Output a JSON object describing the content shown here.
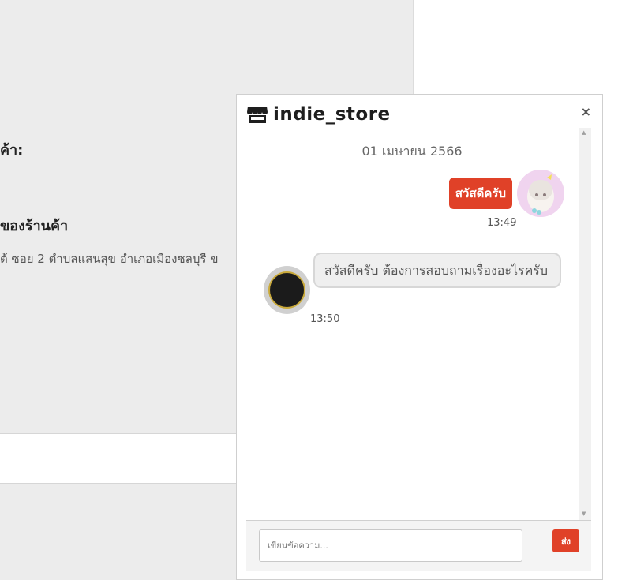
{
  "background": {
    "label_1": "ค้า:",
    "label_2": "ของร้านค้า",
    "address": "ต้ ซอย 2 ตำบลแสนสุข อำเภอเมืองชลบุรี ข"
  },
  "chat": {
    "store_icon": "store-icon",
    "store_name": "indie_store",
    "close_label": "×",
    "date": "01 เมษายน 2566",
    "messages": [
      {
        "direction": "outgoing",
        "text": "สวัสดีครับ",
        "time": "13:49"
      },
      {
        "direction": "incoming",
        "text": "สวัสดีครับ ต้องการสอบถามเรื่องอะไรครับ",
        "time": "13:50"
      }
    ],
    "input_placeholder": "เขียนข้อความ...",
    "send_label": "ส่ง"
  },
  "colors": {
    "accent": "#e04128",
    "bubble_in": "#efefef",
    "background_gray": "#ececec"
  }
}
